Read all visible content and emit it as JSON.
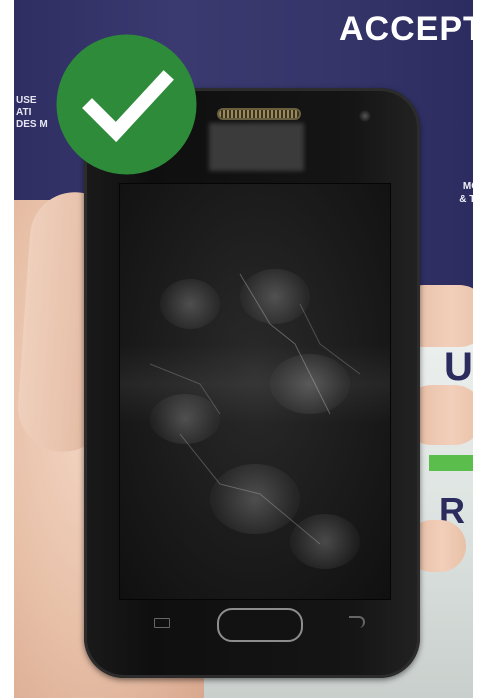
{
  "image": {
    "background_banner_text": "ACCEPT",
    "banner_left_fragment": "USE\nATI\nDES M",
    "banner_right_fragment": "MOBI\n& TAB",
    "letter_right_top": "U",
    "letter_right_bottom": "R",
    "badge": {
      "icon": "checkmark-icon",
      "color": "#2e8b3a"
    },
    "colors": {
      "banner": "#2e2e63",
      "accent_green": "#58b947",
      "phone_body": "#111111"
    }
  }
}
